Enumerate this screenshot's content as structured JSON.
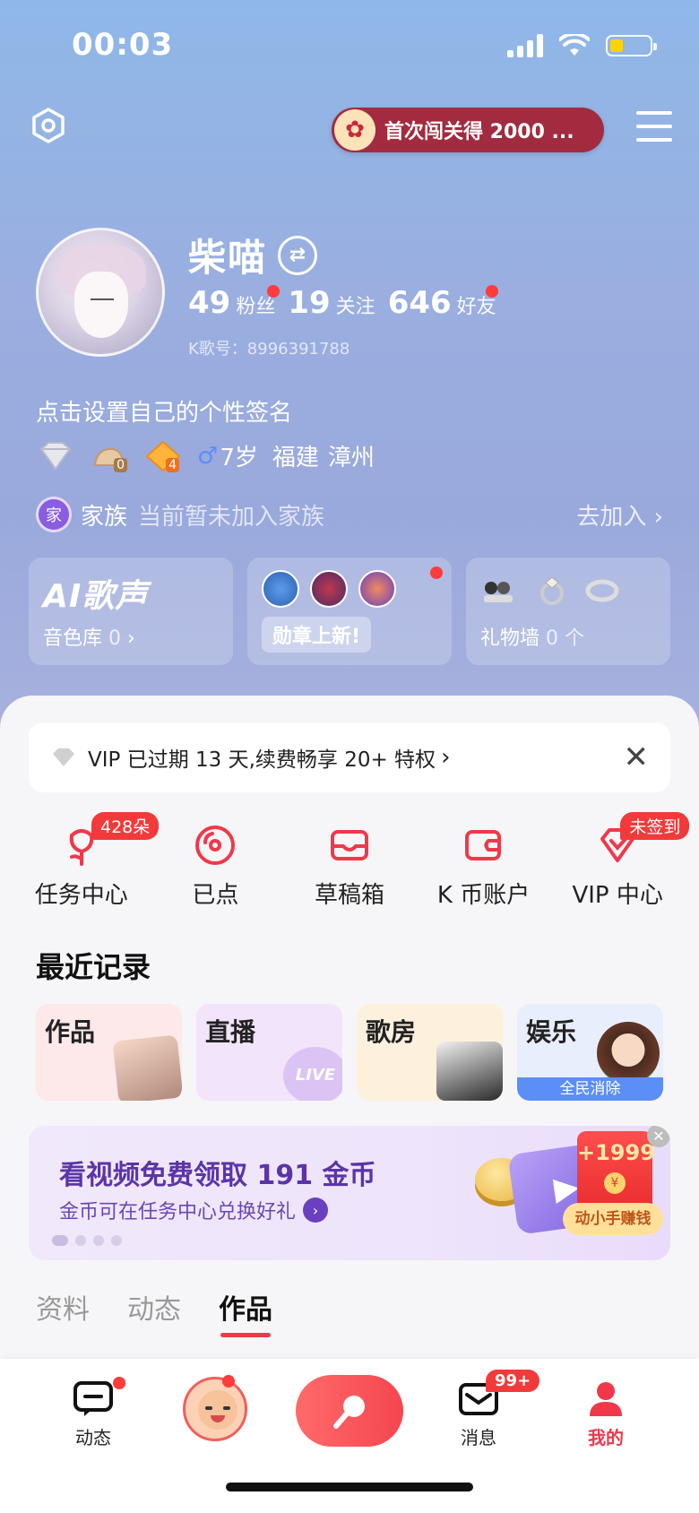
{
  "status_bar": {
    "time": "00:03"
  },
  "top_bar": {
    "promo_text": "首次闯关得 2000 ..."
  },
  "profile": {
    "name": "柴喵",
    "fans_count": "49",
    "fans_label": "粉丝",
    "following_count": "19",
    "following_label": "关注",
    "friends_count": "646",
    "friends_label": "好友",
    "k_id": "K歌号：8996391788",
    "signature": "点击设置自己的个性签名",
    "badge_level_1": "0",
    "badge_level_2": "4",
    "gender_symbol": "♂",
    "age": "7岁",
    "province": "福建",
    "city": "漳州"
  },
  "family": {
    "label": "家族",
    "status": "当前暂未加入家族",
    "join": "去加入",
    "icon_text": "家"
  },
  "cards": {
    "ai": {
      "title": "AI歌声",
      "sub_label": "音色库",
      "sub_count": "0"
    },
    "medals": {
      "tag": "勋章上新!"
    },
    "gifts": {
      "label": "礼物墙",
      "count": "0 个"
    }
  },
  "vip_bar": {
    "text": "VIP 已过期 13 天,续费畅享 20+ 特权"
  },
  "quick_actions": [
    {
      "label": "任务中心",
      "badge": "428朵",
      "icon": "rose-icon"
    },
    {
      "label": "已点",
      "badge": "",
      "icon": "disc-icon"
    },
    {
      "label": "草稿箱",
      "badge": "",
      "icon": "inbox-icon"
    },
    {
      "label": "K 币账户",
      "badge": "",
      "icon": "wallet-icon"
    },
    {
      "label": "VIP 中心",
      "badge": "未签到",
      "icon": "diamond-icon"
    }
  ],
  "recent": {
    "title": "最近记录",
    "items": [
      {
        "title": "作品"
      },
      {
        "title": "直播",
        "thumb_text": "LIVE"
      },
      {
        "title": "歌房"
      },
      {
        "title": "娱乐",
        "caption": "全民消除"
      }
    ]
  },
  "ad": {
    "title": "看视频免费领取 191 金币",
    "subtitle": "金币可在任务中心兑换好礼",
    "amount": "+1999",
    "currency": "¥",
    "tag": "动小手赚钱"
  },
  "profile_tabs": [
    {
      "label": "资料"
    },
    {
      "label": "动态"
    },
    {
      "label": "作品"
    }
  ],
  "bottom_nav": {
    "feed": "动态",
    "messages": "消息",
    "messages_badge": "99+",
    "me": "我的"
  },
  "colors": {
    "accent_red": "#f0384a",
    "hero_blue": "#9aaee0",
    "ad_purple": "#5b34a8"
  }
}
